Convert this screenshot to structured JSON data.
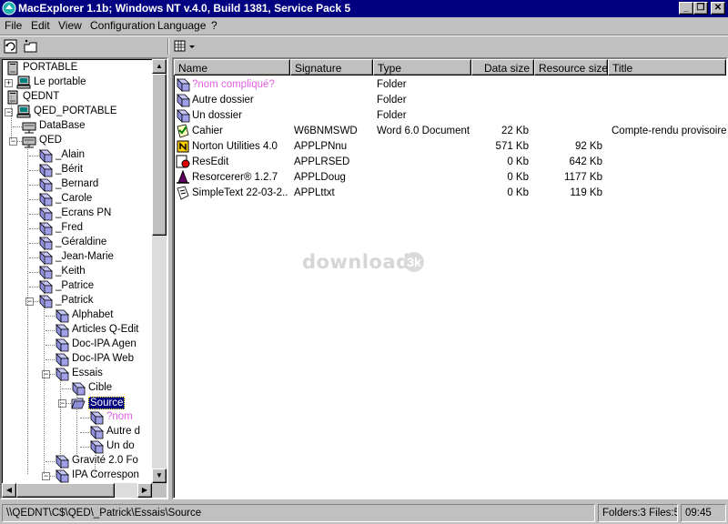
{
  "window": {
    "title": "MacExplorer 1.1b; Windows NT v.4.0, Build 1381, Service Pack 5",
    "buttons": [
      "_",
      "❐",
      "✕"
    ]
  },
  "menu": {
    "file": "File",
    "edit": "Edit",
    "view": "View",
    "configuration": "Configuration",
    "language": "Language",
    "help": "?"
  },
  "tree": {
    "items": [
      {
        "label": "PORTABLE",
        "icon": "drive-icon"
      },
      {
        "label": "Le portable",
        "icon": "network-computer-icon"
      },
      {
        "label": "QEDNT",
        "icon": "drive-icon"
      },
      {
        "label": "QED_PORTABLE",
        "icon": "network-computer-icon"
      },
      {
        "label": "DataBase",
        "icon": "network-share-icon"
      },
      {
        "label": "QED",
        "icon": "network-share-icon"
      },
      {
        "label": "_Alain",
        "icon": "folder-icon"
      },
      {
        "label": "_Bérit",
        "icon": "folder-icon"
      },
      {
        "label": "_Bernard",
        "icon": "folder-icon"
      },
      {
        "label": "_Carole",
        "icon": "folder-icon"
      },
      {
        "label": "_Ecrans PN",
        "icon": "folder-icon"
      },
      {
        "label": "_Fred",
        "icon": "folder-icon"
      },
      {
        "label": "_Géraldine",
        "icon": "folder-icon"
      },
      {
        "label": "_Jean-Marie",
        "icon": "folder-icon"
      },
      {
        "label": "_Keith",
        "icon": "folder-icon"
      },
      {
        "label": "_Patrice",
        "icon": "folder-icon"
      },
      {
        "label": "_Patrick",
        "icon": "folder-icon"
      },
      {
        "label": "Alphabet",
        "icon": "folder-icon"
      },
      {
        "label": "Articles Q-Edit",
        "icon": "folder-icon"
      },
      {
        "label": "Doc-IPA Agen",
        "icon": "folder-icon"
      },
      {
        "label": "Doc-IPA Web",
        "icon": "folder-icon"
      },
      {
        "label": "Essais",
        "icon": "folder-icon"
      },
      {
        "label": "Cible",
        "icon": "folder-icon"
      },
      {
        "label": "Source",
        "icon": "open-folder-icon"
      },
      {
        "label": "?nom",
        "icon": "folder-icon"
      },
      {
        "label": "Autre d",
        "icon": "folder-icon"
      },
      {
        "label": "Un do",
        "icon": "folder-icon"
      },
      {
        "label": "Gravité 2.0 Fo",
        "icon": "folder-icon"
      },
      {
        "label": "IPA Correspon",
        "icon": "folder-icon"
      }
    ]
  },
  "list": {
    "columns": [
      "Name",
      "Signature",
      "Type",
      "Data size",
      "Resource size",
      "Title"
    ],
    "rows": [
      {
        "name": "?nom compliqué?",
        "signature": "",
        "type": "Folder",
        "data_size": "",
        "resource_size": "",
        "title": "",
        "icon": "folder-icon"
      },
      {
        "name": "Autre dossier",
        "signature": "",
        "type": "Folder",
        "data_size": "",
        "resource_size": "",
        "title": "",
        "icon": "folder-icon"
      },
      {
        "name": "Un dossier",
        "signature": "",
        "type": "Folder",
        "data_size": "",
        "resource_size": "",
        "title": "",
        "icon": "folder-icon"
      },
      {
        "name": "Cahier",
        "signature": "W6BNMSWD",
        "type": "Word 6.0 Document",
        "data_size": "22 Kb",
        "resource_size": "",
        "title": "Compte-rendu provisoire",
        "icon": "word-document-icon"
      },
      {
        "name": "Norton Utilities 4.0",
        "signature": "APPLPNnu",
        "type": "",
        "data_size": "571 Kb",
        "resource_size": "92 Kb",
        "title": "",
        "icon": "norton-app-icon"
      },
      {
        "name": "ResEdit",
        "signature": "APPLRSED",
        "type": "",
        "data_size": "0 Kb",
        "resource_size": "642 Kb",
        "title": "",
        "icon": "resedit-app-icon"
      },
      {
        "name": "Resorcerer® 1.2.7",
        "signature": "APPLDoug",
        "type": "",
        "data_size": "0 Kb",
        "resource_size": "1177 Kb",
        "title": "",
        "icon": "resorcerer-app-icon"
      },
      {
        "name": "SimpleText 22-03-2...",
        "signature": "APPLttxt",
        "type": "",
        "data_size": "0 Kb",
        "resource_size": "119 Kb",
        "title": "",
        "icon": "simpletext-app-icon"
      }
    ]
  },
  "watermark": {
    "text": "download",
    "badge": "3k"
  },
  "status": {
    "path": "\\\\QEDNT\\C$\\QED\\_Patrick\\Essais\\Source",
    "counts": "Folders:3 Files:5",
    "time": "09:45"
  },
  "colors": {
    "titlebar": "#000080",
    "selection": "#000080",
    "folder": "#9090e0",
    "pink_text": "#e060e0"
  }
}
